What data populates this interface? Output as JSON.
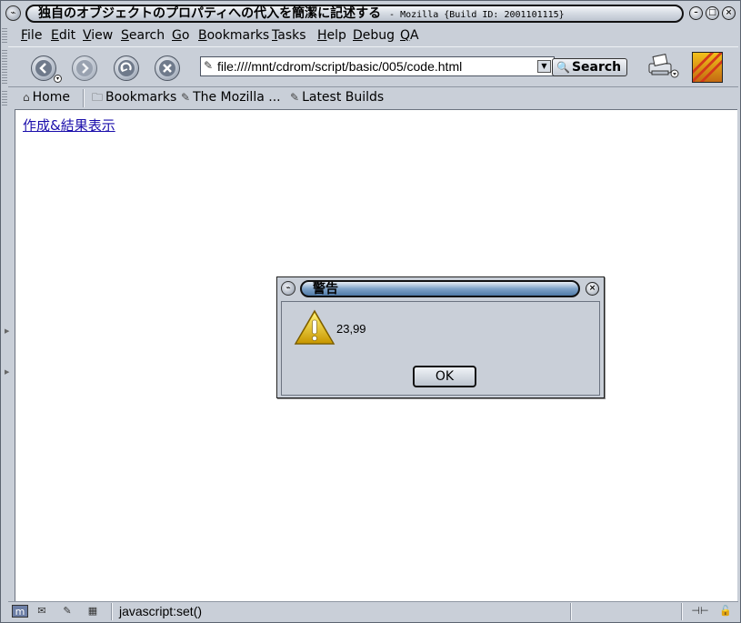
{
  "window": {
    "title": "独自のオブジェクトのプロパティへの代入を簡潔に記述する",
    "title_suffix": "- Mozilla {Build ID: 2001101115}",
    "menu_icon": "window-menu-icon",
    "controls": [
      "minimize-icon",
      "maximize-icon",
      "close-icon"
    ]
  },
  "menubar": {
    "items": [
      {
        "acc": "F",
        "rest": "ile"
      },
      {
        "acc": "E",
        "rest": "dit"
      },
      {
        "acc": "V",
        "rest": "iew"
      },
      {
        "acc": "S",
        "rest": "earch"
      },
      {
        "acc": "G",
        "rest": "o"
      },
      {
        "acc": "B",
        "rest": "ookmarks"
      },
      {
        "acc": "T",
        "rest": "asks"
      },
      {
        "acc": "H",
        "rest": "elp"
      },
      {
        "acc": "D",
        "rest": "ebug"
      },
      {
        "acc": "Q",
        "rest": "A"
      }
    ]
  },
  "navbar": {
    "buttons": [
      "back-icon",
      "forward-icon",
      "reload-icon",
      "stop-icon"
    ],
    "url": "file:////mnt/cdrom/script/basic/005/code.html",
    "search_label": "Search"
  },
  "personalbar": {
    "home": "Home",
    "bookmarks": "Bookmarks",
    "mozilla": "The Mozilla ...",
    "latest": "Latest Builds"
  },
  "content": {
    "link_text": "作成&結果表示"
  },
  "dialog": {
    "title": "警告",
    "message": "23,99",
    "ok_label": "OK"
  },
  "statusbar": {
    "text": "javascript:set()"
  },
  "colors": {
    "chrome": "#c9cfd8",
    "link": "#1a0dab",
    "dialog_title": "#4f7aa8",
    "warning": "#e6b800"
  }
}
